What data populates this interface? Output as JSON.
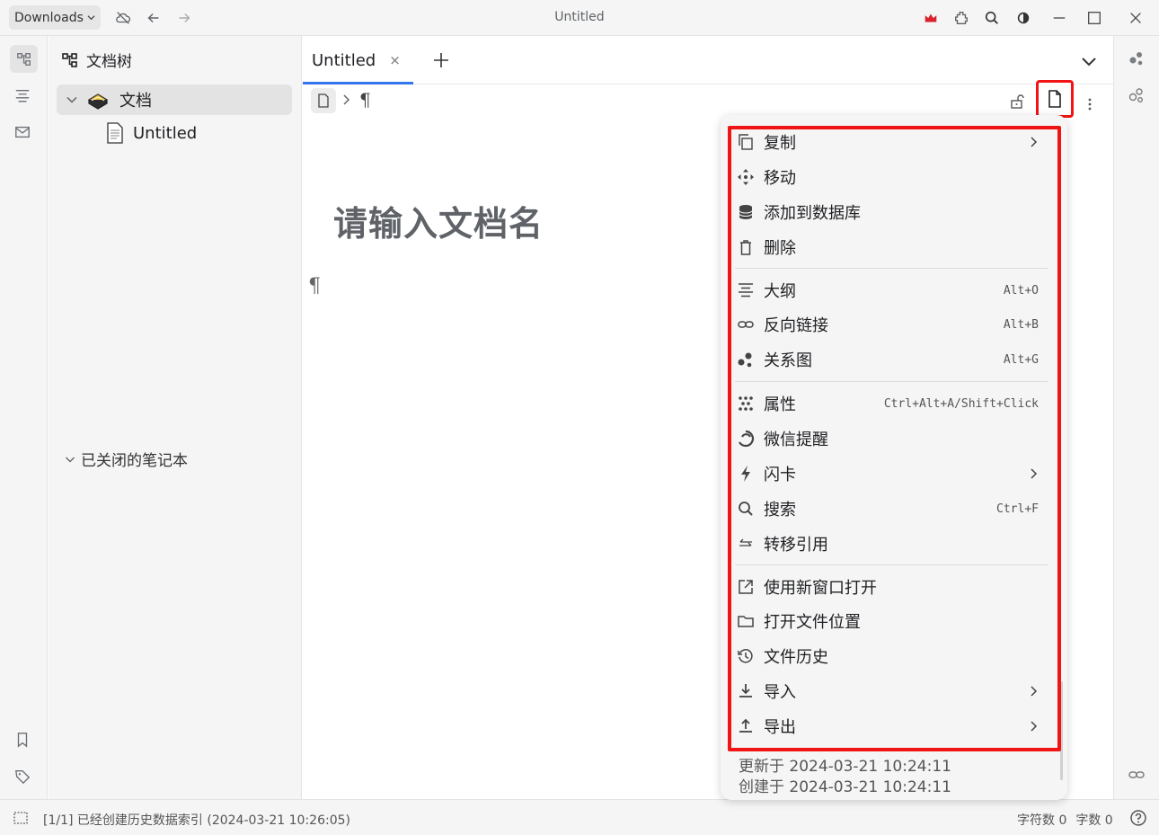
{
  "window": {
    "title": "Untitled",
    "workspace": "Downloads"
  },
  "tree": {
    "header": "文档树",
    "notebook": "文档",
    "doc": "Untitled",
    "closed_notebooks": "已关闭的笔记本"
  },
  "editor": {
    "tab_label": "Untitled",
    "tab_close": "×",
    "title_placeholder": "请输入文档名",
    "paragraph_mark": "¶"
  },
  "menu": {
    "items": [
      {
        "label": "复制",
        "shortcut": "",
        "submenu": true,
        "icon": "copy-icon"
      },
      {
        "label": "移动",
        "shortcut": "",
        "submenu": false,
        "icon": "move-icon"
      },
      {
        "label": "添加到数据库",
        "shortcut": "",
        "submenu": false,
        "icon": "database-icon"
      },
      {
        "label": "删除",
        "shortcut": "",
        "submenu": false,
        "icon": "trash-icon"
      },
      {
        "label": "大纲",
        "shortcut": "Alt+O",
        "submenu": false,
        "icon": "outline-icon"
      },
      {
        "label": "反向链接",
        "shortcut": "Alt+B",
        "submenu": false,
        "icon": "link-icon"
      },
      {
        "label": "关系图",
        "shortcut": "Alt+G",
        "submenu": false,
        "icon": "graph-icon"
      },
      {
        "label": "属性",
        "shortcut": "Ctrl+Alt+A/Shift+Click",
        "submenu": false,
        "icon": "attributes-icon"
      },
      {
        "label": "微信提醒",
        "shortcut": "",
        "submenu": false,
        "icon": "wechat-reminder-icon"
      },
      {
        "label": "闪卡",
        "shortcut": "",
        "submenu": true,
        "icon": "flashcard-icon"
      },
      {
        "label": "搜索",
        "shortcut": "Ctrl+F",
        "submenu": false,
        "icon": "search-icon"
      },
      {
        "label": "转移引用",
        "shortcut": "",
        "submenu": false,
        "icon": "transfer-icon"
      },
      {
        "label": "使用新窗口打开",
        "shortcut": "",
        "submenu": false,
        "icon": "new-window-icon"
      },
      {
        "label": "打开文件位置",
        "shortcut": "",
        "submenu": false,
        "icon": "folder-icon"
      },
      {
        "label": "文件历史",
        "shortcut": "",
        "submenu": false,
        "icon": "history-icon"
      },
      {
        "label": "导入",
        "shortcut": "",
        "submenu": true,
        "icon": "import-icon"
      },
      {
        "label": "导出",
        "shortcut": "",
        "submenu": true,
        "icon": "export-icon"
      }
    ],
    "updated": "更新于 2024-03-21 10:24:11",
    "created": "创建于 2024-03-21 10:24:11"
  },
  "status": {
    "message": "[1/1] 已经创建历史数据索引 (2024-03-21 10:26:05)",
    "char_count": "字符数 0",
    "word_count": "字数 0"
  },
  "colors": {
    "accent": "#3575f0",
    "highlight": "#f01414",
    "crown": "#d9232d"
  }
}
